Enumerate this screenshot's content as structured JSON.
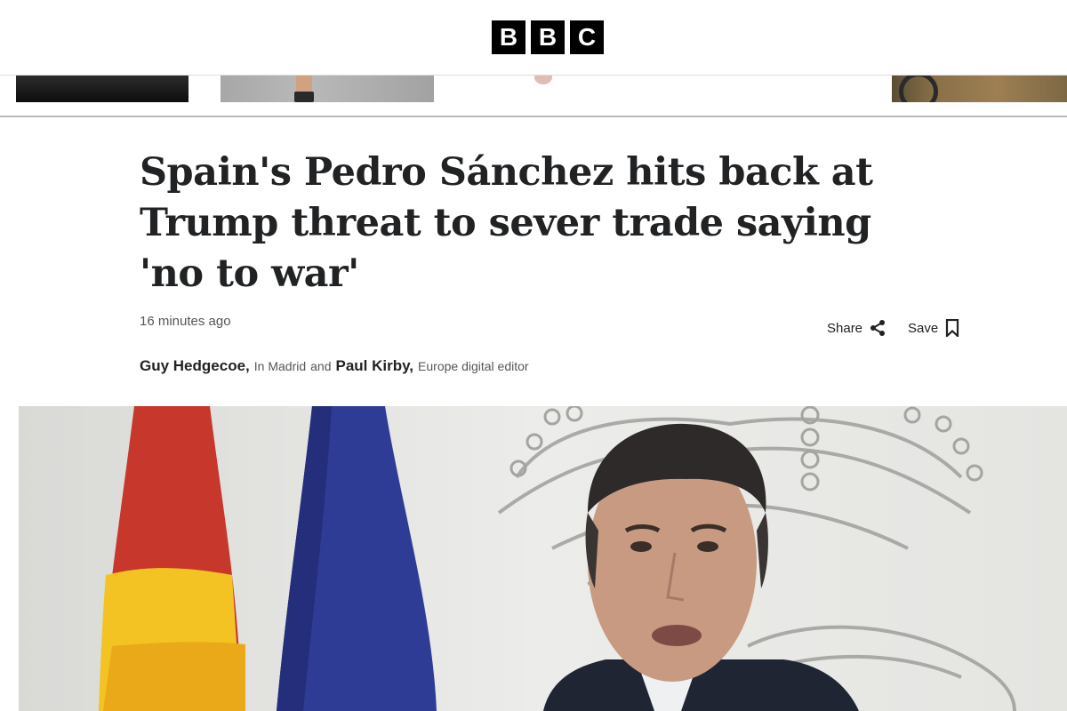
{
  "header": {
    "logo_letters": [
      "B",
      "B",
      "C"
    ]
  },
  "article": {
    "headline": "Spain's Pedro Sánchez hits back at Trump threat to sever trade saying 'no to war'",
    "timestamp": "16 minutes ago",
    "actions": {
      "share_label": "Share",
      "share_icon": "share-icon",
      "save_label": "Save",
      "save_icon": "bookmark-icon"
    },
    "byline": {
      "author1_name": "Guy Hedgecoe,",
      "author1_location": "In Madrid",
      "conjunction": "and",
      "author2_name": "Paul Kirby,",
      "author2_role": "Europe digital editor"
    }
  },
  "colors": {
    "text_primary": "#202224",
    "text_secondary": "#545658",
    "logo_bg": "#000000"
  }
}
